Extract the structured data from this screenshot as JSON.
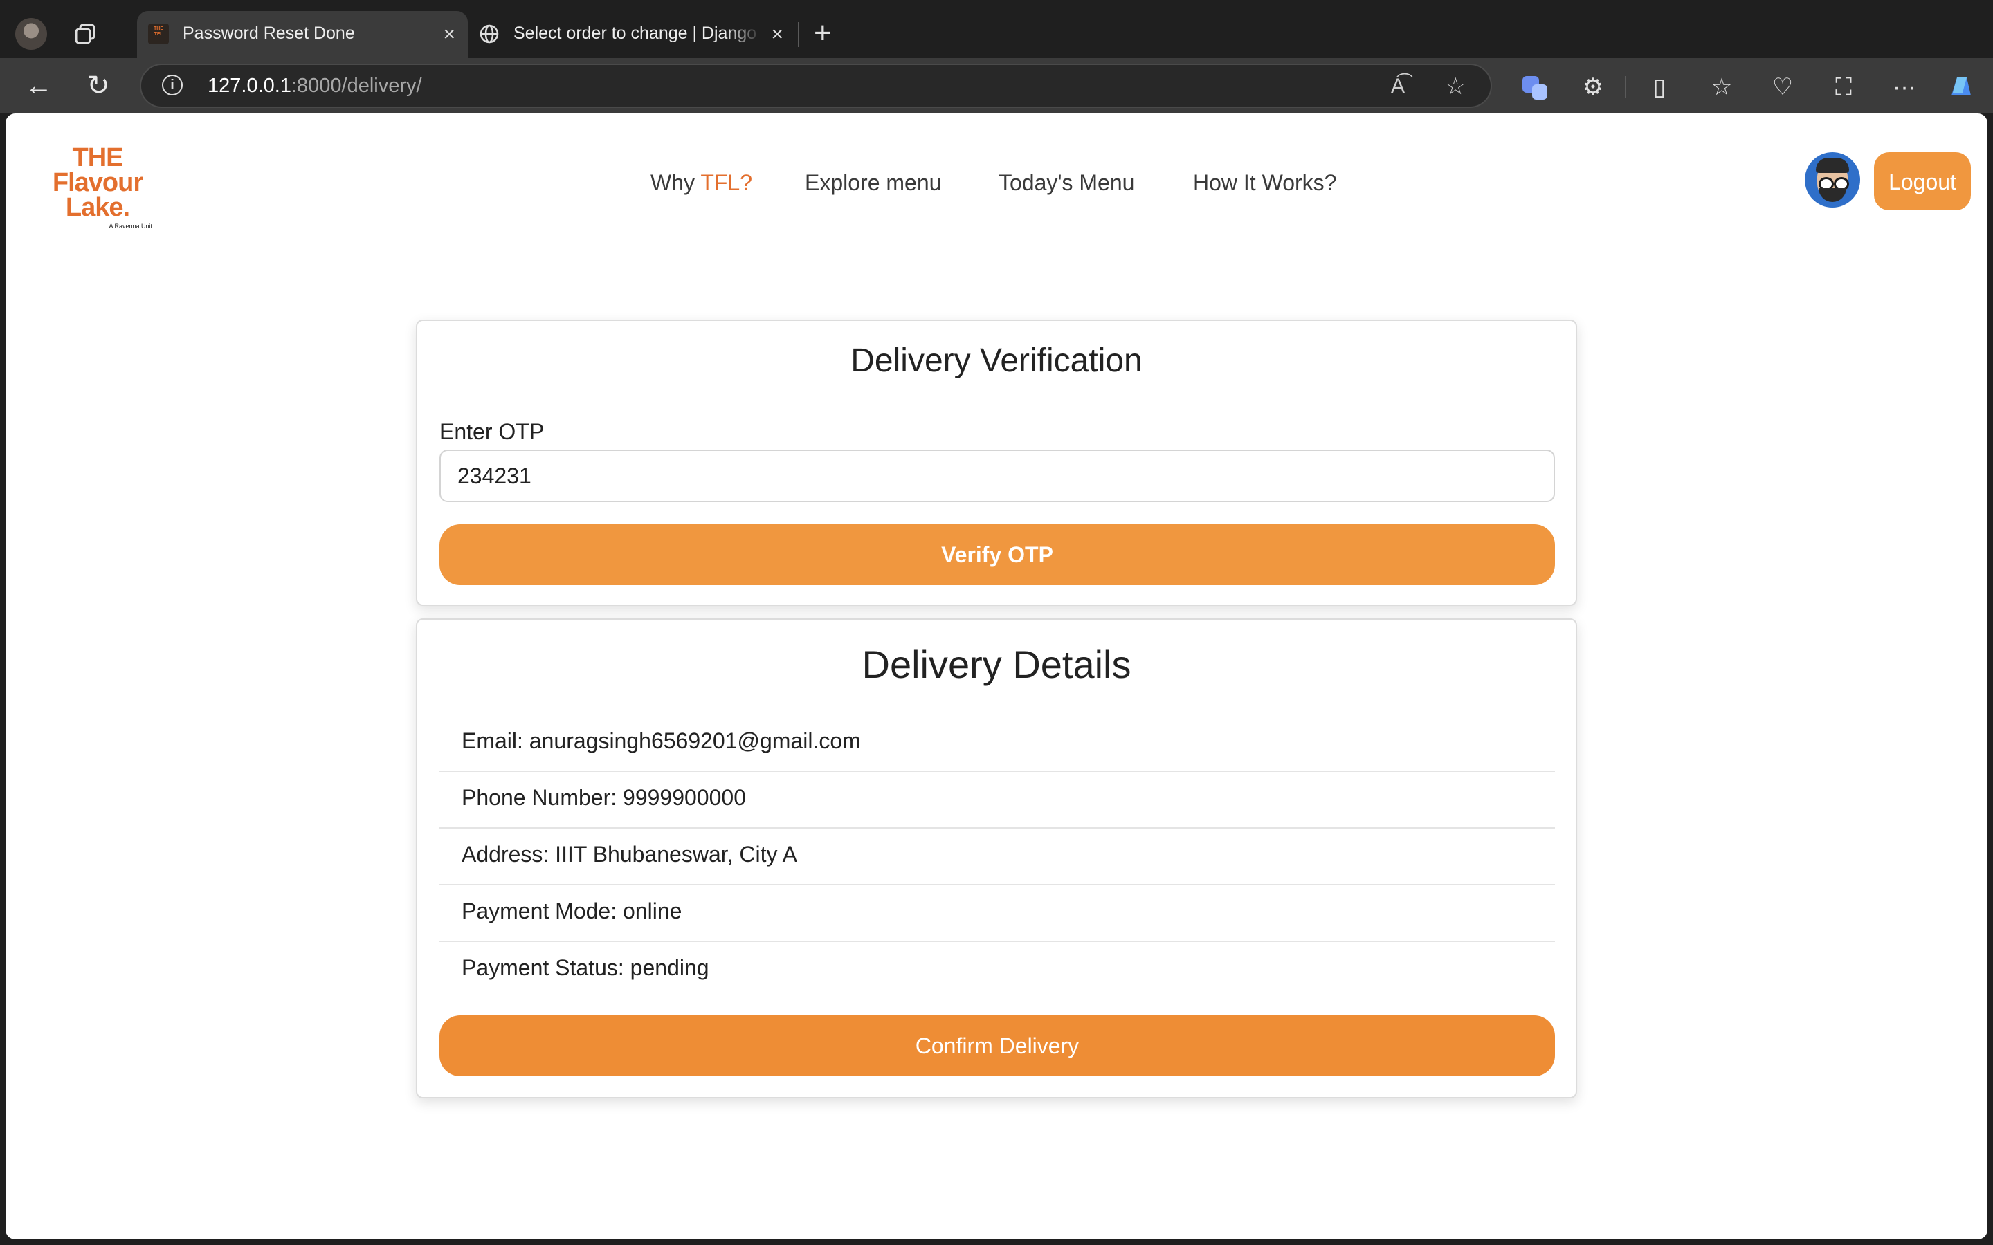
{
  "browser": {
    "tabs": [
      {
        "title": "Password Reset Done",
        "favicon": "tfl-logo-icon",
        "active": true
      },
      {
        "title": "Select order to change | Django",
        "favicon": "globe-icon",
        "active": false
      }
    ],
    "new_tab_label": "+",
    "url_host": "127.0.0.1",
    "url_rest": ":8000/delivery/"
  },
  "header": {
    "logo": {
      "line1": "THE",
      "line2": "Flavour",
      "line3": "Lake.",
      "tagline": "A Ravenna Unit"
    },
    "nav": [
      {
        "prefix": "Why ",
        "accent": "TFL?"
      },
      {
        "label": "Explore menu"
      },
      {
        "label": "Today's Menu"
      },
      {
        "label": "How It Works?"
      }
    ],
    "logout_label": "Logout"
  },
  "verification": {
    "title": "Delivery Verification",
    "otp_label": "Enter OTP",
    "otp_value": "234231",
    "verify_label": "Verify OTP"
  },
  "details": {
    "title": "Delivery Details",
    "rows": [
      "Email: anuragsingh6569201@gmail.com",
      "Phone Number: 9999900000",
      "Address: IIIT Bhubaneswar, City A",
      "Payment Mode: online",
      "Payment Status: pending"
    ],
    "confirm_label": "Confirm Delivery"
  },
  "colors": {
    "accent": "#f0973f",
    "brand": "#e36f2e"
  }
}
